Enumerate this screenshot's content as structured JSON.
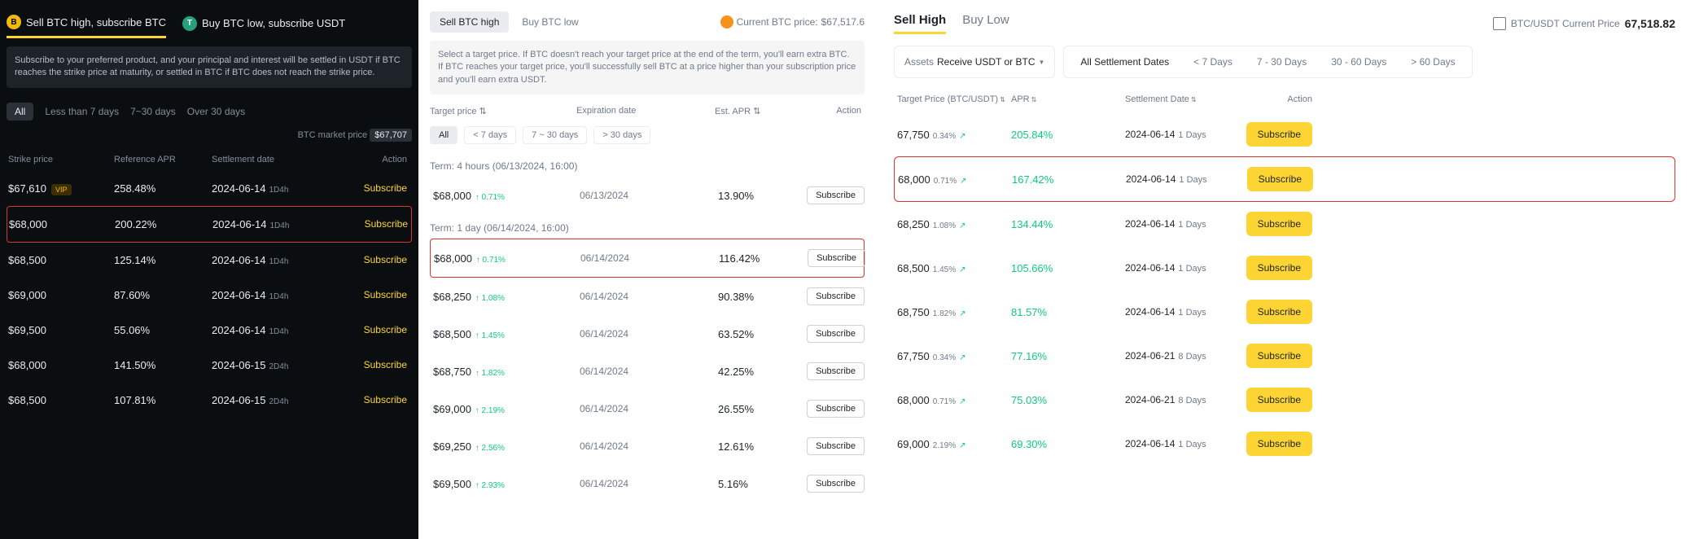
{
  "panel1": {
    "modeTabs": [
      {
        "label": "Sell BTC high, subscribe BTC",
        "active": true,
        "iconClass": "y",
        "iconText": "B"
      },
      {
        "label": "Buy BTC low, subscribe USDT",
        "active": false,
        "iconClass": "g",
        "iconText": "T"
      }
    ],
    "description": "Subscribe to your preferred product, and your principal and interest will be settled in USDT if BTC reaches the strike price at maturity, or settled in BTC if BTC does not reach the strike price.",
    "filters": [
      "All",
      "Less than 7 days",
      "7~30 days",
      "Over 30 days"
    ],
    "activeFilter": 0,
    "marketLabel": "BTC market price",
    "marketPrice": "$67,707",
    "columns": {
      "strike": "Strike price",
      "apr": "Reference APR",
      "settle": "Settlement date",
      "action": "Action"
    },
    "rows": [
      {
        "strike": "$67,610",
        "vip": true,
        "apr": "258.48%",
        "date": "2024-06-14",
        "dur": "1D4h",
        "highlight": false
      },
      {
        "strike": "$68,000",
        "vip": false,
        "apr": "200.22%",
        "date": "2024-06-14",
        "dur": "1D4h",
        "highlight": true
      },
      {
        "strike": "$68,500",
        "vip": false,
        "apr": "125.14%",
        "date": "2024-06-14",
        "dur": "1D4h",
        "highlight": false
      },
      {
        "strike": "$69,000",
        "vip": false,
        "apr": "87.60%",
        "date": "2024-06-14",
        "dur": "1D4h",
        "highlight": false
      },
      {
        "strike": "$69,500",
        "vip": false,
        "apr": "55.06%",
        "date": "2024-06-14",
        "dur": "1D4h",
        "highlight": false
      },
      {
        "strike": "$68,000",
        "vip": false,
        "apr": "141.50%",
        "date": "2024-06-15",
        "dur": "2D4h",
        "highlight": false
      },
      {
        "strike": "$68,500",
        "vip": false,
        "apr": "107.81%",
        "date": "2024-06-15",
        "dur": "2D4h",
        "highlight": false
      }
    ],
    "subscribeLabel": "Subscribe",
    "vipLabel": "VIP"
  },
  "panel2": {
    "topTabs": [
      {
        "label": "Sell BTC high",
        "active": true
      },
      {
        "label": "Buy BTC low",
        "active": false
      }
    ],
    "priceLabel": "Current BTC price:",
    "priceValue": "$67,517.6",
    "description": "Select a target price. If BTC doesn't reach your target price at the end of the term, you'll earn extra BTC. If BTC reaches your target price, you'll successfully sell BTC at a price higher than your subscription price and you'll earn extra USDT.",
    "columns": {
      "target": "Target price",
      "exp": "Expiration date",
      "apr": "Est. APR",
      "action": "Action"
    },
    "filters": [
      "All",
      "< 7 days",
      "7 ~ 30 days",
      "> 30 days"
    ],
    "activeFilter": 0,
    "groups": [
      {
        "term": "Term: 4 hours (06/13/2024, 16:00)",
        "rows": [
          {
            "price": "$68,000",
            "delta": "↑ 0.71%",
            "exp": "06/13/2024",
            "apr": "13.90%",
            "highlight": false
          }
        ]
      },
      {
        "term": "Term: 1 day (06/14/2024, 16:00)",
        "rows": [
          {
            "price": "$68,000",
            "delta": "↑ 0.71%",
            "exp": "06/14/2024",
            "apr": "116.42%",
            "highlight": true
          },
          {
            "price": "$68,250",
            "delta": "↑ 1.08%",
            "exp": "06/14/2024",
            "apr": "90.38%",
            "highlight": false
          },
          {
            "price": "$68,500",
            "delta": "↑ 1.45%",
            "exp": "06/14/2024",
            "apr": "63.52%",
            "highlight": false
          },
          {
            "price": "$68,750",
            "delta": "↑ 1.82%",
            "exp": "06/14/2024",
            "apr": "42.25%",
            "highlight": false
          },
          {
            "price": "$69,000",
            "delta": "↑ 2.19%",
            "exp": "06/14/2024",
            "apr": "26.55%",
            "highlight": false
          },
          {
            "price": "$69,250",
            "delta": "↑ 2.56%",
            "exp": "06/14/2024",
            "apr": "12.61%",
            "highlight": false
          },
          {
            "price": "$69,500",
            "delta": "↑ 2.93%",
            "exp": "06/14/2024",
            "apr": "5.16%",
            "highlight": false
          }
        ]
      }
    ],
    "subscribeLabel": "Subscribe"
  },
  "panel3": {
    "tabs": [
      {
        "label": "Sell High",
        "active": true
      },
      {
        "label": "Buy Low",
        "active": false
      }
    ],
    "priceLabel": "BTC/USDT Current Price",
    "priceValue": "67,518.82",
    "assetsLabel": "Assets",
    "receiveLabel": "Receive USDT or BTC",
    "settlementFilters": [
      "All Settlement Dates",
      "< 7 Days",
      "7 - 30 Days",
      "30 - 60 Days",
      "> 60 Days"
    ],
    "activeSettlement": 0,
    "columns": {
      "target": "Target Price (BTC/USDT)",
      "apr": "APR",
      "settle": "Settlement Date",
      "action": "Action"
    },
    "rows": [
      {
        "price": "67,750",
        "delta": "0.34%",
        "apr": "205.84%",
        "date": "2024-06-14",
        "days": "1 Days",
        "highlight": false
      },
      {
        "price": "68,000",
        "delta": "0.71%",
        "apr": "167.42%",
        "date": "2024-06-14",
        "days": "1 Days",
        "highlight": true
      },
      {
        "price": "68,250",
        "delta": "1.08%",
        "apr": "134.44%",
        "date": "2024-06-14",
        "days": "1 Days",
        "highlight": false
      },
      {
        "price": "68,500",
        "delta": "1.45%",
        "apr": "105.66%",
        "date": "2024-06-14",
        "days": "1 Days",
        "highlight": false
      },
      {
        "price": "68,750",
        "delta": "1.82%",
        "apr": "81.57%",
        "date": "2024-06-14",
        "days": "1 Days",
        "highlight": false
      },
      {
        "price": "67,750",
        "delta": "0.34%",
        "apr": "77.16%",
        "date": "2024-06-21",
        "days": "8 Days",
        "highlight": false
      },
      {
        "price": "68,000",
        "delta": "0.71%",
        "apr": "75.03%",
        "date": "2024-06-21",
        "days": "8 Days",
        "highlight": false
      },
      {
        "price": "69,000",
        "delta": "2.19%",
        "apr": "69.30%",
        "date": "2024-06-14",
        "days": "1 Days",
        "highlight": false
      }
    ],
    "subscribeLabel": "Subscribe"
  }
}
